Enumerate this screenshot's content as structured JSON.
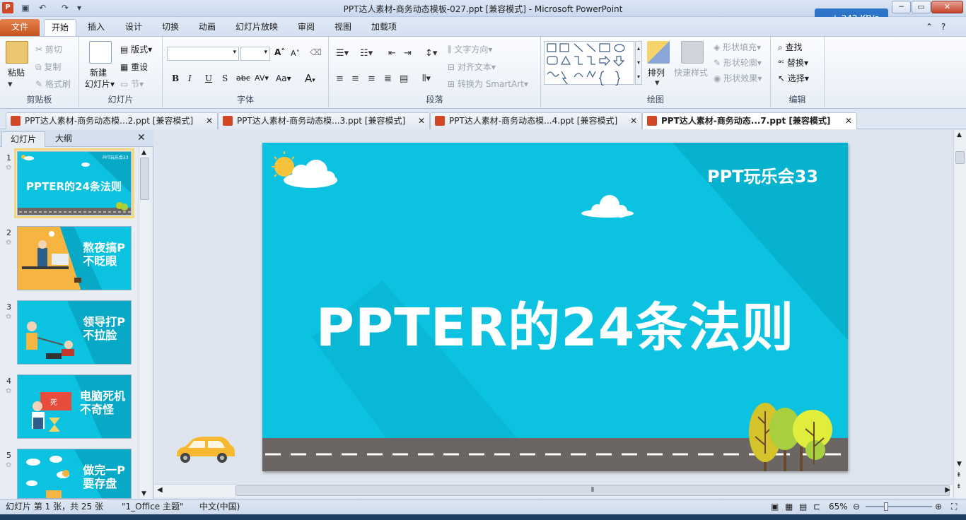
{
  "window": {
    "title": "PPT达人素材-商务动态模板-027.ppt [兼容模式]  -  Microsoft PowerPoint"
  },
  "speed": "242 KB/s",
  "tabs": [
    "文件",
    "开始",
    "插入",
    "设计",
    "切换",
    "动画",
    "幻灯片放映",
    "审阅",
    "视图",
    "加载项"
  ],
  "ribbon": {
    "clipboard": {
      "paste": "粘贴",
      "cut": "剪切",
      "copy": "复制",
      "format_painter": "格式刷",
      "label": "剪贴板"
    },
    "slides": {
      "new_slide_1": "新建",
      "new_slide_2": "幻灯片",
      "layout": "版式",
      "reset": "重设",
      "section": "节",
      "label": "幻灯片"
    },
    "font": {
      "label": "字体",
      "bold": "B",
      "italic": "I",
      "underline": "U",
      "shadow": "S",
      "strike": "abc",
      "spacing": "AV",
      "case": "Aa",
      "grow": "A",
      "shrink": "A",
      "color": "A"
    },
    "paragraph": {
      "text_direction": "文字方向",
      "align_text": "对齐文本",
      "smartart": "转换为 SmartArt",
      "label": "段落"
    },
    "drawing": {
      "arrange": "排列",
      "quick_styles": "快速样式",
      "shape_fill": "形状填充",
      "shape_outline": "形状轮廓",
      "shape_effects": "形状效果",
      "label": "绘图"
    },
    "editing": {
      "find": "查找",
      "replace": "替换",
      "select": "选择",
      "label": "编辑"
    }
  },
  "doc_tabs": [
    {
      "label": "PPT达人素材-商务动态模...2.ppt [兼容模式]",
      "active": false
    },
    {
      "label": "PPT达人素材-商务动态模...3.ppt [兼容模式]",
      "active": false
    },
    {
      "label": "PPT达人素材-商务动态模...4.ppt [兼容模式]",
      "active": false
    },
    {
      "label": "PPT达人素材-商务动态...7.ppt [兼容模式]",
      "active": true
    }
  ],
  "pane_tabs": {
    "slides": "幻灯片",
    "outline": "大纲"
  },
  "thumbnails": [
    {
      "num": "1",
      "caption": "PPTER的24条法则",
      "tag": "PPT玩乐会33"
    },
    {
      "num": "2",
      "caption": "熬夜搞P\n不眨眼"
    },
    {
      "num": "3",
      "caption": "领导打P\n不拉脸"
    },
    {
      "num": "4",
      "caption": "电脑死机\n不奇怪",
      "badge": "死"
    },
    {
      "num": "5",
      "caption": "做完一P\n要存盘"
    }
  ],
  "slide": {
    "tag": "PPT玩乐会33",
    "title": "PPTER的24条法则"
  },
  "status": {
    "slide_count": "幻灯片 第 1 张，共 25 张",
    "theme": "\"1_Office 主题\"",
    "language": "中文(中国)",
    "zoom": "65%"
  },
  "colors": {
    "slide_bg": "#0bc2e0",
    "road": "#6b6663",
    "accent": "#d24726"
  }
}
